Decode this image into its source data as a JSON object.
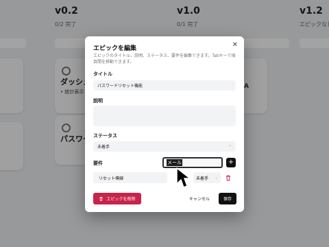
{
  "board": {
    "columns": [
      {
        "title": "v0.2",
        "sub": "0/2 完了"
      },
      {
        "title": "v1.0",
        "sub": "0/1 完了"
      },
      {
        "title": "v1.2",
        "sub": "エピックなし"
      }
    ],
    "cards": [
      {
        "title": "ダッシュ",
        "meta": "• 統計表示"
      },
      {
        "title": "パスワー"
      }
    ],
    "peek_letter": "A"
  },
  "modal": {
    "title": "エピックを編集",
    "close_icon": "close-icon",
    "description": "エピックのタイトル、説明、ステータス、要件を編集できます。Tabキーで項目間を移動できます。",
    "title_label": "タイトル",
    "title_value": "パスワードリセット機能",
    "description_label": "説明",
    "description_value": "",
    "status_label": "ステータス",
    "status_value": "未着手",
    "requirements_label": "要件",
    "requirement_input": {
      "selected_text": "メール",
      "caret_text": ""
    },
    "add_button": "+",
    "requirements": [
      {
        "name": "リセット導線",
        "status": "未着手",
        "delete_icon": "trash-icon"
      }
    ],
    "delete_button": "エピックを削除",
    "cancel_button": "キャンセル",
    "save_button": "保存"
  },
  "colors": {
    "danger": "#c8234a",
    "primary": "#111111"
  }
}
